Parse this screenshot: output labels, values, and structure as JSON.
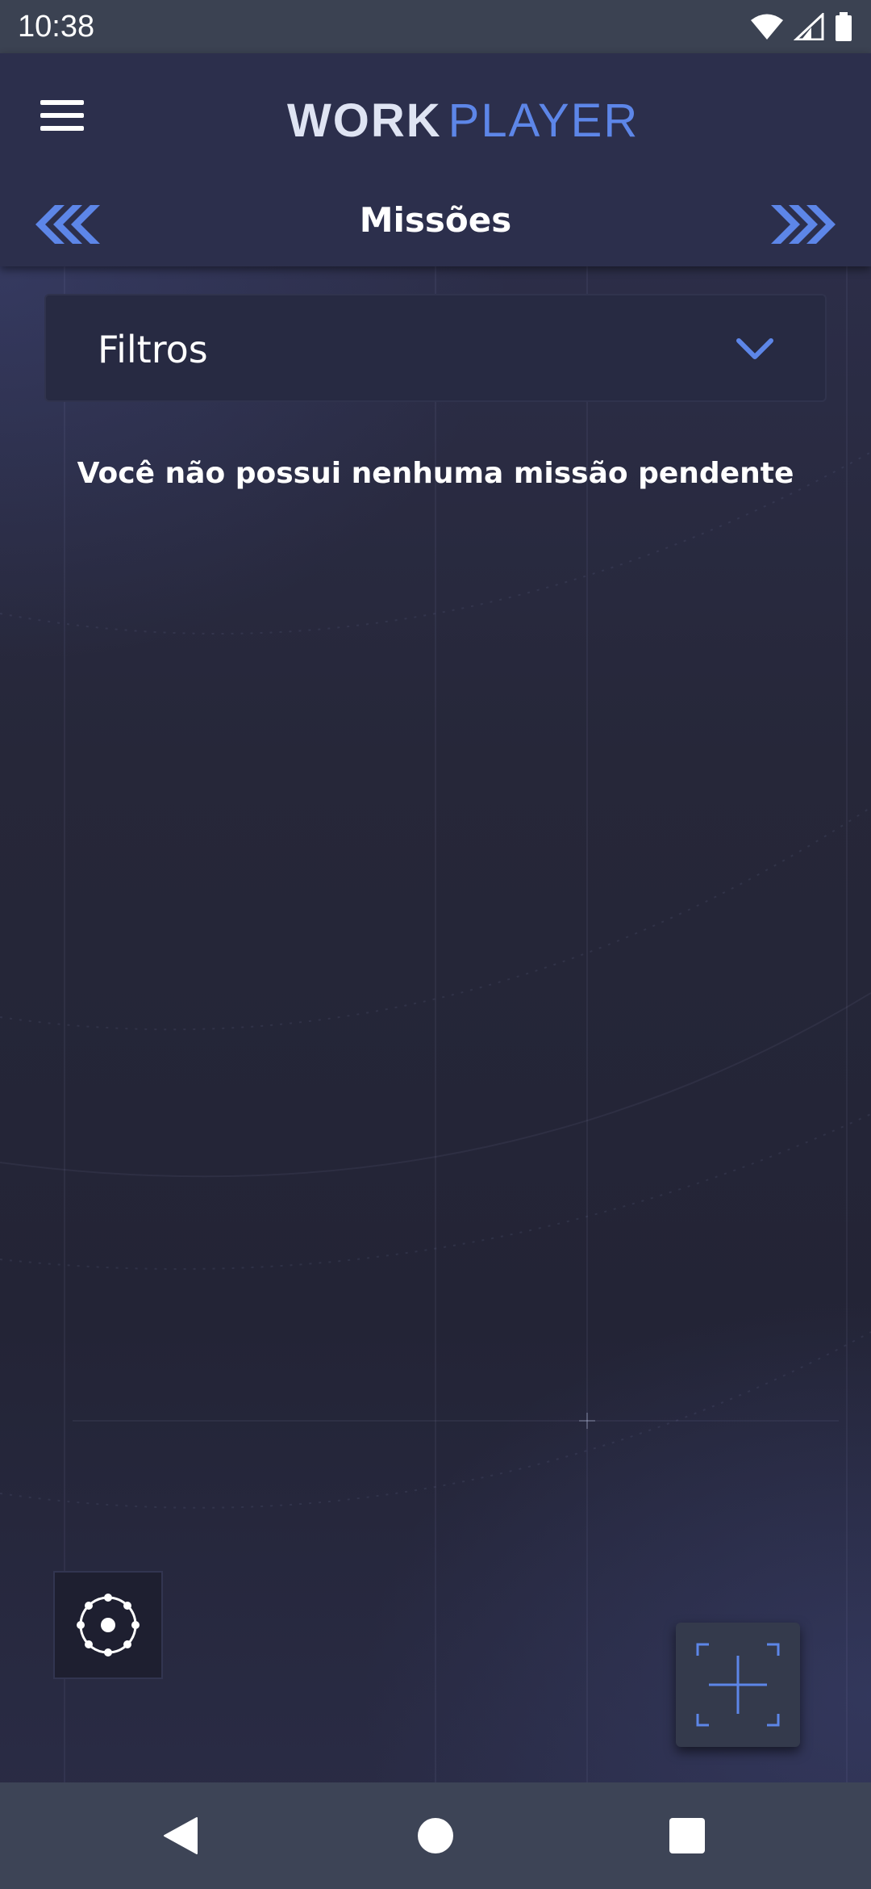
{
  "status_bar": {
    "time": "10:38",
    "icons": [
      "wifi-icon",
      "signal-icon",
      "battery-icon"
    ]
  },
  "header": {
    "logo_work": "WORK",
    "logo_player": "PLAYER",
    "title": "Missões",
    "menu_icon": "hamburger-menu-icon",
    "prev_icon": "triple-chevron-left-icon",
    "next_icon": "triple-chevron-right-icon"
  },
  "filter": {
    "label": "Filtros",
    "icon": "chevron-down-icon"
  },
  "empty_message": "Você não possui nenhuma missão pendente",
  "actions": {
    "orbit_icon": "orbit-icon",
    "fab_icon": "scan-add-icon"
  },
  "nav_bar": {
    "icons": [
      "back-icon",
      "home-icon",
      "recent-apps-icon"
    ]
  },
  "colors": {
    "accent": "#5d86e8",
    "header_bg": "#2c2f4c",
    "status_bg": "#3b4252",
    "nav_bg": "#3d4456"
  }
}
